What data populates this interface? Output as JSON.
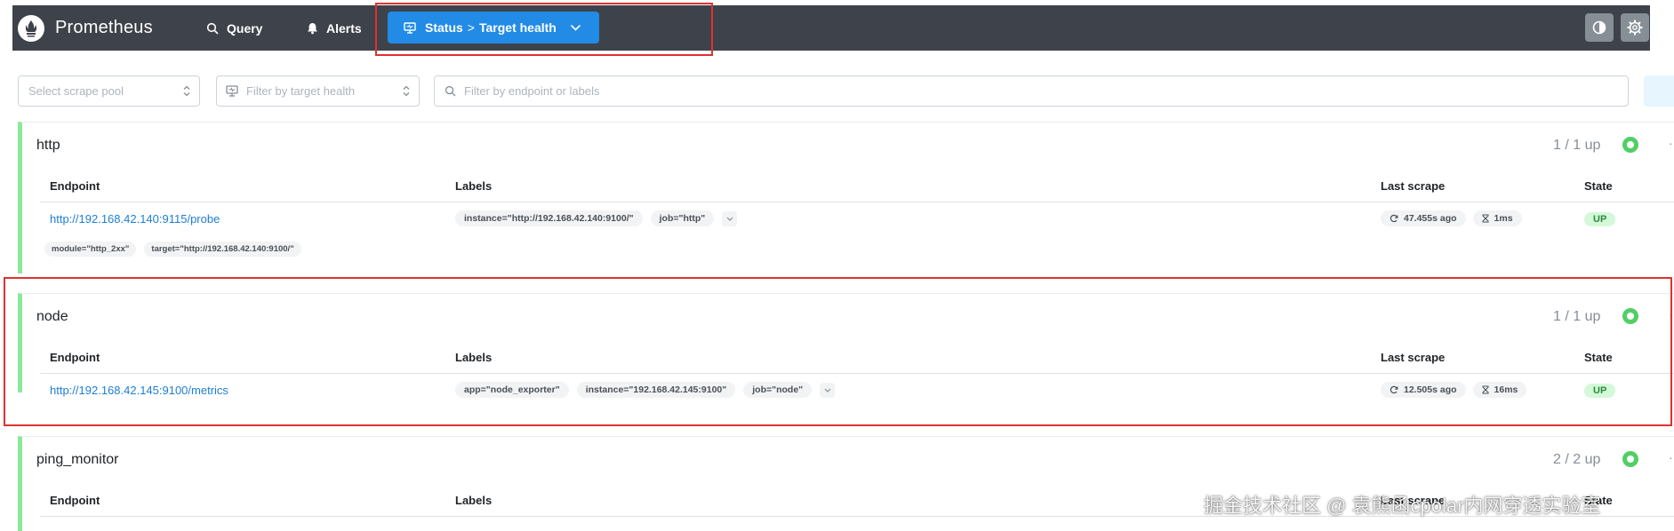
{
  "header": {
    "app_title": "Prometheus",
    "nav": {
      "query": "Query",
      "alerts": "Alerts"
    },
    "status": {
      "section": "Status",
      "separator": ">",
      "page": "Target health"
    }
  },
  "icons": {
    "logo": "prometheus-logo-icon",
    "query": "search-icon",
    "alerts": "bell-icon",
    "status": "monitor-icon",
    "theme": "contrast-icon",
    "settings": "gear-icon"
  },
  "colors": {
    "header_bg": "#3e424a",
    "accent": "#228be6",
    "up_green": "#51cf66",
    "highlight_red": "#e03131"
  },
  "filters": {
    "scrape_pool_placeholder": "Select scrape pool",
    "health_placeholder": "Filter by target health",
    "search_placeholder": "Filter by endpoint or labels"
  },
  "columns": {
    "endpoint": "Endpoint",
    "labels": "Labels",
    "last_scrape": "Last scrape",
    "state": "State"
  },
  "pools": [
    {
      "name": "http",
      "count": "1 / 1 up",
      "targets": [
        {
          "endpoint": "http://192.168.42.140:9115/probe",
          "labels": [
            "instance=\"http://192.168.42.140:9100/\"",
            "job=\"http\""
          ],
          "discovered_labels": [
            "module=\"http_2xx\"",
            "target=\"http://192.168.42.140:9100/\""
          ],
          "last_scrape": "47.455s ago",
          "duration": "1ms",
          "state": "UP"
        }
      ]
    },
    {
      "name": "node",
      "count": "1 / 1 up",
      "targets": [
        {
          "endpoint": "http://192.168.42.145:9100/metrics",
          "labels": [
            "app=\"node_exporter\"",
            "instance=\"192.168.42.145:9100\"",
            "job=\"node\""
          ],
          "last_scrape": "12.505s ago",
          "duration": "16ms",
          "state": "UP"
        }
      ]
    },
    {
      "name": "ping_monitor",
      "count": "2 / 2 up"
    }
  ],
  "watermark": "掘金技术社区 @ 袁熊函cpolar内网穿透实验室"
}
